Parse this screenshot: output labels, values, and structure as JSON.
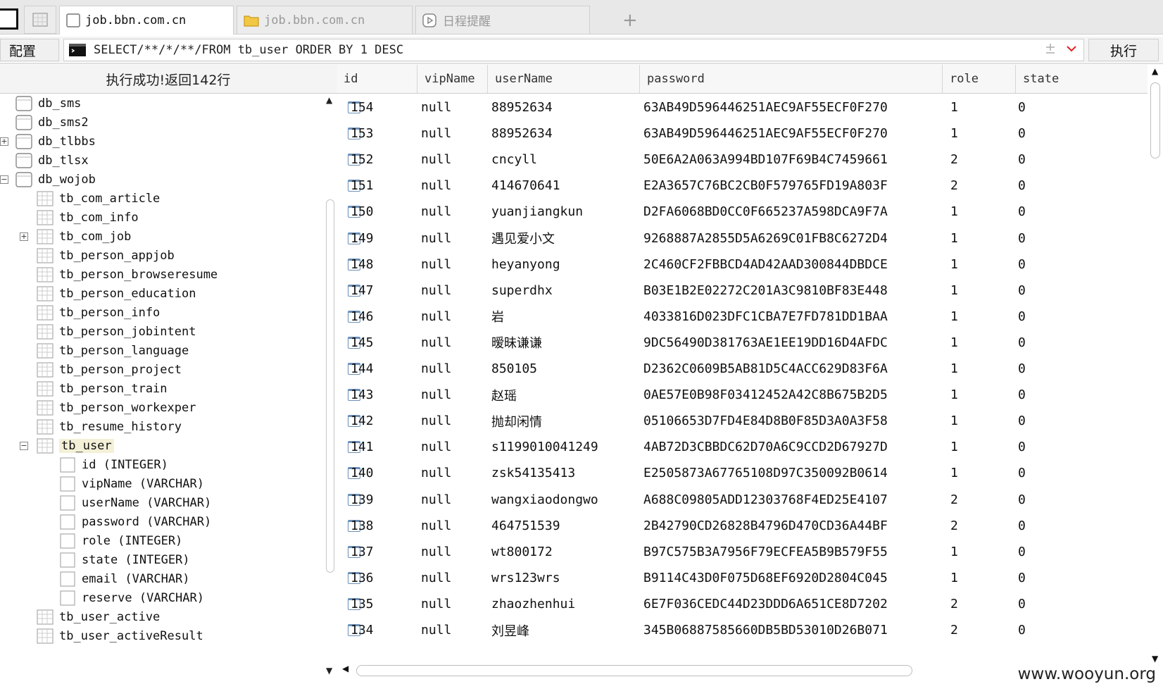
{
  "tabs": [
    {
      "label": "job.bbn.com.cn",
      "icon": "page-icon",
      "active": true
    },
    {
      "label": "job.bbn.com.cn",
      "icon": "folder-icon",
      "active": false
    },
    {
      "label": "日程提醒",
      "icon": "clock-icon",
      "active": false
    }
  ],
  "toolbar": {
    "config_label": "配置",
    "sql": "SELECT/**/*/**/FROM tb_user ORDER BY 1 DESC",
    "exec_label": "执行"
  },
  "status": {
    "text": "执行成功!返回142行"
  },
  "tree": {
    "nodes": [
      {
        "label": "db_sms",
        "level": 0,
        "icon": "database-icon",
        "expander": ""
      },
      {
        "label": "db_sms2",
        "level": 0,
        "icon": "database-icon",
        "expander": ""
      },
      {
        "label": "db_tlbbs",
        "level": 0,
        "icon": "database-icon",
        "expander": "+"
      },
      {
        "label": "db_tlsx",
        "level": 0,
        "icon": "database-icon",
        "expander": ""
      },
      {
        "label": "db_wojob",
        "level": 0,
        "icon": "database-icon",
        "expander": "−"
      },
      {
        "label": "tb_com_article",
        "level": 1,
        "icon": "table-icon",
        "expander": ""
      },
      {
        "label": "tb_com_info",
        "level": 1,
        "icon": "table-icon",
        "expander": ""
      },
      {
        "label": "tb_com_job",
        "level": 1,
        "icon": "table-icon",
        "expander": "+"
      },
      {
        "label": "tb_person_appjob",
        "level": 1,
        "icon": "table-icon",
        "expander": ""
      },
      {
        "label": "tb_person_browseresume",
        "level": 1,
        "icon": "table-icon",
        "expander": ""
      },
      {
        "label": "tb_person_education",
        "level": 1,
        "icon": "table-icon",
        "expander": ""
      },
      {
        "label": "tb_person_info",
        "level": 1,
        "icon": "table-icon",
        "expander": ""
      },
      {
        "label": "tb_person_jobintent",
        "level": 1,
        "icon": "table-icon",
        "expander": ""
      },
      {
        "label": "tb_person_language",
        "level": 1,
        "icon": "table-icon",
        "expander": ""
      },
      {
        "label": "tb_person_project",
        "level": 1,
        "icon": "table-icon",
        "expander": ""
      },
      {
        "label": "tb_person_train",
        "level": 1,
        "icon": "table-icon",
        "expander": ""
      },
      {
        "label": "tb_person_workexper",
        "level": 1,
        "icon": "table-icon",
        "expander": ""
      },
      {
        "label": "tb_resume_history",
        "level": 1,
        "icon": "table-icon",
        "expander": ""
      },
      {
        "label": "tb_user",
        "level": 1,
        "icon": "table-icon",
        "expander": "−",
        "selected": true
      },
      {
        "label": "id (INTEGER)",
        "level": 2,
        "icon": "column-icon",
        "expander": ""
      },
      {
        "label": "vipName (VARCHAR)",
        "level": 2,
        "icon": "column-icon",
        "expander": ""
      },
      {
        "label": "userName (VARCHAR)",
        "level": 2,
        "icon": "column-icon",
        "expander": ""
      },
      {
        "label": "password (VARCHAR)",
        "level": 2,
        "icon": "column-icon",
        "expander": ""
      },
      {
        "label": "role (INTEGER)",
        "level": 2,
        "icon": "column-icon",
        "expander": ""
      },
      {
        "label": "state (INTEGER)",
        "level": 2,
        "icon": "column-icon",
        "expander": ""
      },
      {
        "label": "email (VARCHAR)",
        "level": 2,
        "icon": "column-icon",
        "expander": ""
      },
      {
        "label": "reserve (VARCHAR)",
        "level": 2,
        "icon": "column-icon",
        "expander": ""
      },
      {
        "label": "tb_user_active",
        "level": 1,
        "icon": "table-icon",
        "expander": ""
      },
      {
        "label": "tb_user_activeResult",
        "level": 1,
        "icon": "table-icon",
        "expander": ""
      }
    ]
  },
  "grid": {
    "columns": [
      "id",
      "vipName",
      "userName",
      "password",
      "role",
      "state"
    ],
    "rows": [
      [
        "154",
        "null",
        "88952634",
        "63AB49D596446251AEC9AF55ECF0F270",
        "1",
        "0"
      ],
      [
        "153",
        "null",
        "88952634",
        "63AB49D596446251AEC9AF55ECF0F270",
        "1",
        "0"
      ],
      [
        "152",
        "null",
        "cncyll",
        "50E6A2A063A994BD107F69B4C7459661",
        "2",
        "0"
      ],
      [
        "151",
        "null",
        "414670641",
        "E2A3657C76BC2CB0F579765FD19A803F",
        "2",
        "0"
      ],
      [
        "150",
        "null",
        "yuanjiangkun",
        "D2FA6068BD0CC0F665237A598DCA9F7A",
        "1",
        "0"
      ],
      [
        "149",
        "null",
        "遇见爱小文",
        "9268887A2855D5A6269C01FB8C6272D4",
        "1",
        "0"
      ],
      [
        "148",
        "null",
        "heyanyong",
        "2C460CF2FBBCD4AD42AAD300844DBDCE",
        "1",
        "0"
      ],
      [
        "147",
        "null",
        "superdhx",
        "B03E1B2E02272C201A3C9810BF83E448",
        "1",
        "0"
      ],
      [
        "146",
        "null",
        "岩",
        "4033816D023DFC1CBA7E7FD781DD1BAA",
        "1",
        "0"
      ],
      [
        "145",
        "null",
        "暧昧谦谦",
        "9DC56490D381763AE1EE19DD16D4AFDC",
        "1",
        "0"
      ],
      [
        "144",
        "null",
        "850105",
        "D2362C0609B5AB81D5C4ACC629D83F6A",
        "1",
        "0"
      ],
      [
        "143",
        "null",
        "赵瑶",
        "0AE57E0B98F03412452A42C8B675B2D5",
        "1",
        "0"
      ],
      [
        "142",
        "null",
        "抛却闲情",
        "05106653D7FD4E84D8B0F85D3A0A3F58",
        "1",
        "0"
      ],
      [
        "141",
        "null",
        "s1199010041249",
        "4AB72D3CBBDC62D70A6C9CCD2D67927D",
        "1",
        "0"
      ],
      [
        "140",
        "null",
        "zsk54135413",
        "E2505873A67765108D97C350092B0614",
        "1",
        "0"
      ],
      [
        "139",
        "null",
        "wangxiaodongwo",
        "A688C09805ADD12303768F4ED25E4107",
        "2",
        "0"
      ],
      [
        "138",
        "null",
        "464751539",
        "2B42790CD26828B4796D470CD36A44BF",
        "2",
        "0"
      ],
      [
        "137",
        "null",
        "wt800172",
        "B97C575B3A7956F79ECFEA5B9B579F55",
        "1",
        "0"
      ],
      [
        "136",
        "null",
        "wrs123wrs",
        "B9114C43D0F075D68EF6920D2804C045",
        "1",
        "0"
      ],
      [
        "135",
        "null",
        "zhaozhenhui",
        "6E7F036CEDC44D23DDD6A651CE8D7202",
        "2",
        "0"
      ],
      [
        "134",
        "null",
        "刘昱峰",
        "345B06887585660DB5BD53010D26B071",
        "2",
        "0"
      ]
    ]
  },
  "watermark": "www.wooyun.org",
  "colors": {
    "accent": "#6a8fb8",
    "border": "#cfcfcf",
    "selected": "#f4f0d8"
  }
}
